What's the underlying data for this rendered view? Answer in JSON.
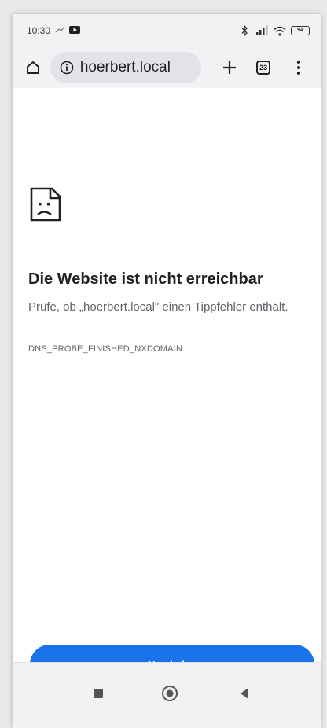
{
  "status_bar": {
    "time": "10:30",
    "battery": "94"
  },
  "toolbar": {
    "url": "hoerbert.local",
    "tab_count": "23"
  },
  "error": {
    "title": "Die Website ist nicht erreichbar",
    "description": "Prüfe, ob „hoerbert.local\" einen Tippfehler enthält.",
    "code": "DNS_PROBE_FINISHED_NXDOMAIN"
  },
  "actions": {
    "reload_label": "Neu laden"
  },
  "colors": {
    "accent": "#1a73e8",
    "chrome_bg": "#f2f2f4",
    "omnibox_bg": "#e2e3e8"
  },
  "icons": [
    "home-icon",
    "info-icon",
    "plus-icon",
    "tabs-icon",
    "more-vert-icon",
    "sad-page-icon",
    "nav-recents-icon",
    "nav-home-icon",
    "nav-back-icon",
    "bluetooth-icon",
    "signal-icon",
    "wifi-icon",
    "battery-icon"
  ]
}
